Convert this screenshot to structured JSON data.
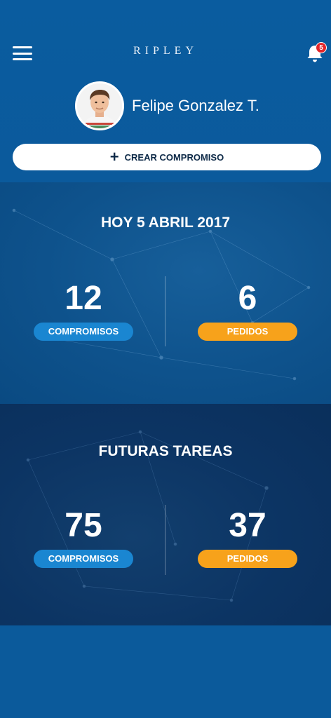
{
  "header": {
    "brand": "RIPLEY",
    "notifications_count": "5",
    "user_name": "Felipe Gonzalez T.",
    "create_button_label": "CREAR COMPROMISO"
  },
  "today": {
    "title": "HOY 5 ABRIL 2017",
    "commitments_count": "12",
    "commitments_label": "COMPROMISOS",
    "orders_count": "6",
    "orders_label": "PEDIDOS"
  },
  "future": {
    "title": "FUTURAS TAREAS",
    "commitments_count": "75",
    "commitments_label": "COMPROMISOS",
    "orders_count": "37",
    "orders_label": "PEDIDOS"
  },
  "colors": {
    "primary_blue": "#0b5a9b",
    "pill_blue": "#1a86d1",
    "pill_orange": "#f7a21b",
    "badge_red": "#e3262a"
  },
  "icons": {
    "menu": "hamburger-menu-icon",
    "notifications": "bell-icon",
    "create": "plus-icon"
  }
}
